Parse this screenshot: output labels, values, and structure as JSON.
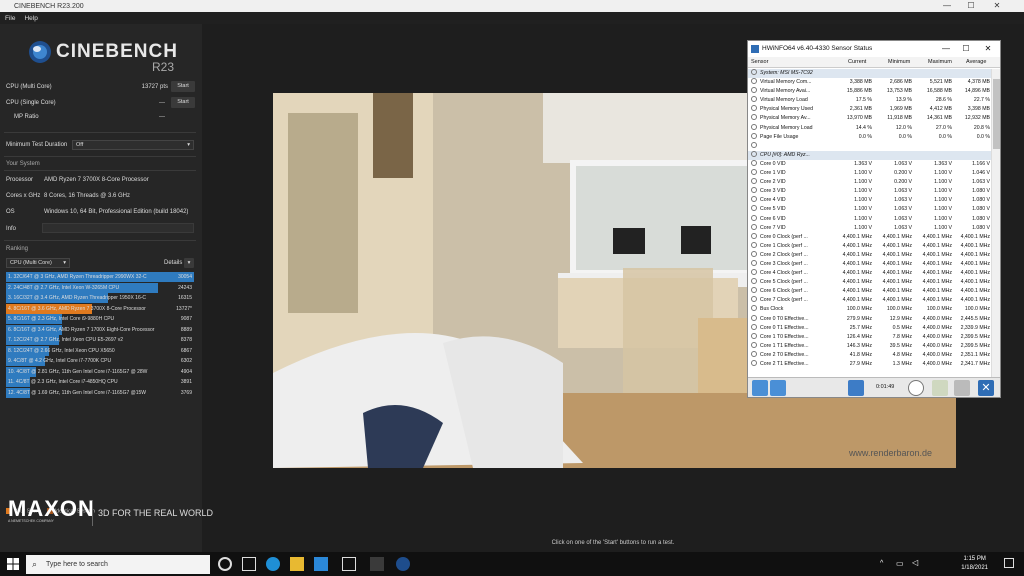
{
  "window": {
    "title": "CINEBENCH R23.200",
    "minimize": "—",
    "maximize": "☐",
    "close": "✕"
  },
  "menu": [
    "File",
    "Help"
  ],
  "logo": {
    "name": "CINEBENCH",
    "version": "R23"
  },
  "tests": {
    "multi_label": "CPU (Multi Core)",
    "multi_score": "13727 pts",
    "multi_btn": "Start",
    "single_label": "CPU (Single Core)",
    "single_score": "---",
    "single_btn": "Start",
    "mp_label": "MP Ratio",
    "mp_value": "---"
  },
  "min_duration": {
    "label": "Minimum Test Duration",
    "value": "Off"
  },
  "system": {
    "header": "Your System",
    "processor_label": "Processor",
    "processor_value": "AMD Ryzen 7 3700X 8-Core Processor",
    "cores_label": "Cores x GHz",
    "cores_value": "8 Cores, 16 Threads @ 3.6 GHz",
    "os_label": "OS",
    "os_value": "Windows 10, 64 Bit, Professional Edition (build 18042)",
    "info_label": "Info",
    "info_value": ""
  },
  "ranking": {
    "header": "Ranking",
    "select": "CPU (Multi Core)",
    "details": "Details",
    "items": [
      {
        "label": "1. 32C/64T @ 3 GHz, AMD Ryzen Threadripper 2990WX 32-C",
        "score": "30054",
        "pct": 100,
        "color": "#2f7bbf"
      },
      {
        "label": "2. 24C/48T @ 2.7 GHz, Intel Xeon W-3265M CPU",
        "score": "24243",
        "pct": 81,
        "color": "#2f7bbf"
      },
      {
        "label": "3. 16C/32T @ 3.4 GHz, AMD Ryzen Threadripper 1950X 16-C",
        "score": "16315",
        "pct": 54,
        "color": "#2f7bbf"
      },
      {
        "label": "4. 8C/16T @ 3.6 GHz, AMD Ryzen 7 3700X 8-Core Processor",
        "score": "13727*",
        "pct": 46,
        "color": "#e07a1f"
      },
      {
        "label": "5. 8C/16T @ 2.3 GHz, Intel Core i9-9880H CPU",
        "score": "9087",
        "pct": 30,
        "color": "#2f7bbf"
      },
      {
        "label": "6. 8C/16T @ 3.4 GHz, AMD Ryzen 7 1700X Eight-Core Processor",
        "score": "8889",
        "pct": 30,
        "color": "#2f7bbf"
      },
      {
        "label": "7. 12C/24T @ 2.7 GHz, Intel Xeon CPU E5-2697 v2",
        "score": "8378",
        "pct": 28,
        "color": "#2f7bbf"
      },
      {
        "label": "8. 12C/24T @ 2.66 GHz, Intel Xeon CPU X5650",
        "score": "6867",
        "pct": 23,
        "color": "#2f7bbf"
      },
      {
        "label": "9. 4C/8T @ 4.2 GHz, Intel Core i7-7700K CPU",
        "score": "6302",
        "pct": 21,
        "color": "#2f7bbf"
      },
      {
        "label": "10. 4C/8T @ 2.81 GHz, 11th Gen Intel Core i7-1165G7 @ 28W",
        "score": "4904",
        "pct": 16,
        "color": "#2f7bbf"
      },
      {
        "label": "11. 4C/8T @ 2.3 GHz, Intel Core i7-4850HQ CPU",
        "score": "3891",
        "pct": 13,
        "color": "#2f7bbf"
      },
      {
        "label": "12. 4C/8T @ 1.69 GHz, 11th Gen Intel Core i7-1165G7 @15W",
        "score": "3769",
        "pct": 13,
        "color": "#2f7bbf"
      }
    ]
  },
  "legend": {
    "your_score": "Your Score",
    "identical": "Identical System",
    "your_color": "#e07a1f",
    "identical_color": "#a0521a"
  },
  "brand": {
    "name": "MAXON",
    "sub": "A NEMETSCHEK COMPANY",
    "tagline": "3D FOR THE REAL WORLD"
  },
  "render": {
    "watermark": "www.renderbaron.de"
  },
  "status": "Click on one of the 'Start' buttons to run a test.",
  "hwinfo": {
    "title": "HWiNFO64 v6.40-4330 Sensor Status",
    "cols": [
      "Sensor",
      "Current",
      "Minimum",
      "Maximum",
      "Average"
    ],
    "rows": [
      {
        "n": "System: MSI MS-7C92",
        "g": true
      },
      {
        "n": "Virtual Memory Com...",
        "v": [
          "3,388 MB",
          "2,686 MB",
          "5,521 MB",
          "4,378 MB"
        ]
      },
      {
        "n": "Virtual Memory Avai...",
        "v": [
          "15,886 MB",
          "13,753 MB",
          "16,588 MB",
          "14,896 MB"
        ]
      },
      {
        "n": "Virtual Memory Load",
        "v": [
          "17.5 %",
          "13.9 %",
          "28.6 %",
          "22.7 %"
        ]
      },
      {
        "n": "Physical Memory Used",
        "v": [
          "2,361 MB",
          "1,969 MB",
          "4,412 MB",
          "3,398 MB"
        ]
      },
      {
        "n": "Physical Memory Av...",
        "v": [
          "13,970 MB",
          "11,918 MB",
          "14,361 MB",
          "12,932 MB"
        ]
      },
      {
        "n": "Physical Memory Load",
        "v": [
          "14.4 %",
          "12.0 %",
          "27.0 %",
          "20.8 %"
        ]
      },
      {
        "n": "Page File Usage",
        "v": [
          "0.0 %",
          "0.0 %",
          "0.0 %",
          "0.0 %"
        ]
      },
      {
        "n": "",
        "v": [
          "",
          "",
          "",
          ""
        ]
      },
      {
        "n": "CPU [#0]: AMD Ryz...",
        "g": true
      },
      {
        "n": "Core 0 VID",
        "v": [
          "1.363 V",
          "1.063 V",
          "1.363 V",
          "1.166 V"
        ]
      },
      {
        "n": "Core 1 VID",
        "v": [
          "1.100 V",
          "0.200 V",
          "1.100 V",
          "1.046 V"
        ]
      },
      {
        "n": "Core 2 VID",
        "v": [
          "1.100 V",
          "0.200 V",
          "1.100 V",
          "1.063 V"
        ]
      },
      {
        "n": "Core 3 VID",
        "v": [
          "1.100 V",
          "1.063 V",
          "1.100 V",
          "1.080 V"
        ]
      },
      {
        "n": "Core 4 VID",
        "v": [
          "1.100 V",
          "1.063 V",
          "1.100 V",
          "1.080 V"
        ]
      },
      {
        "n": "Core 5 VID",
        "v": [
          "1.100 V",
          "1.063 V",
          "1.100 V",
          "1.080 V"
        ]
      },
      {
        "n": "Core 6 VID",
        "v": [
          "1.100 V",
          "1.063 V",
          "1.100 V",
          "1.080 V"
        ]
      },
      {
        "n": "Core 7 VID",
        "v": [
          "1.100 V",
          "1.063 V",
          "1.100 V",
          "1.080 V"
        ]
      },
      {
        "n": "Core 0 Clock (perf ...",
        "v": [
          "4,400.1 MHz",
          "4,400.1 MHz",
          "4,400.1 MHz",
          "4,400.1 MHz"
        ]
      },
      {
        "n": "Core 1 Clock (perf ...",
        "v": [
          "4,400.1 MHz",
          "4,400.1 MHz",
          "4,400.1 MHz",
          "4,400.1 MHz"
        ]
      },
      {
        "n": "Core 2 Clock (perf ...",
        "v": [
          "4,400.1 MHz",
          "4,400.1 MHz",
          "4,400.1 MHz",
          "4,400.1 MHz"
        ]
      },
      {
        "n": "Core 3 Clock (perf ...",
        "v": [
          "4,400.1 MHz",
          "4,400.1 MHz",
          "4,400.1 MHz",
          "4,400.1 MHz"
        ]
      },
      {
        "n": "Core 4 Clock (perf ...",
        "v": [
          "4,400.1 MHz",
          "4,400.1 MHz",
          "4,400.1 MHz",
          "4,400.1 MHz"
        ]
      },
      {
        "n": "Core 5 Clock (perf ...",
        "v": [
          "4,400.1 MHz",
          "4,400.1 MHz",
          "4,400.1 MHz",
          "4,400.1 MHz"
        ]
      },
      {
        "n": "Core 6 Clock (perf ...",
        "v": [
          "4,400.1 MHz",
          "4,400.1 MHz",
          "4,400.1 MHz",
          "4,400.1 MHz"
        ]
      },
      {
        "n": "Core 7 Clock (perf ...",
        "v": [
          "4,400.1 MHz",
          "4,400.1 MHz",
          "4,400.1 MHz",
          "4,400.1 MHz"
        ]
      },
      {
        "n": "Bus Clock",
        "v": [
          "100.0 MHz",
          "100.0 MHz",
          "100.0 MHz",
          "100.0 MHz"
        ]
      },
      {
        "n": "Core 0 T0 Effective...",
        "v": [
          "279.9 MHz",
          "12.9 MHz",
          "4,400.0 MHz",
          "2,445.5 MHz"
        ]
      },
      {
        "n": "Core 0 T1 Effective...",
        "v": [
          "25.7 MHz",
          "0.5 MHz",
          "4,400.0 MHz",
          "2,339.9 MHz"
        ]
      },
      {
        "n": "Core 1 T0 Effective...",
        "v": [
          "126.4 MHz",
          "7.8 MHz",
          "4,400.0 MHz",
          "2,399.5 MHz"
        ]
      },
      {
        "n": "Core 1 T1 Effective...",
        "v": [
          "146.3 MHz",
          "39.5 MHz",
          "4,400.0 MHz",
          "2,399.5 MHz"
        ]
      },
      {
        "n": "Core 2 T0 Effective...",
        "v": [
          "41.8 MHz",
          "4.8 MHz",
          "4,400.0 MHz",
          "2,351.1 MHz"
        ]
      },
      {
        "n": "Core 2 T1 Effective...",
        "v": [
          "27.9 MHz",
          "1.3 MHz",
          "4,400.0 MHz",
          "2,341.7 MHz"
        ]
      }
    ],
    "timer": "0:01:49"
  },
  "taskbar": {
    "search_placeholder": "Type here to search",
    "time": "1:15 PM",
    "date": "1/18/2021"
  }
}
